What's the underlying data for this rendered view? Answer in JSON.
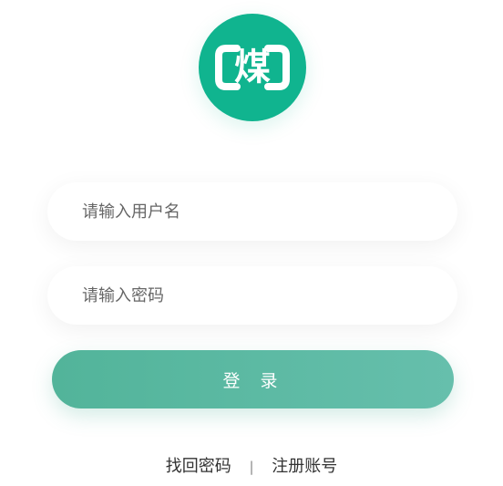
{
  "logo": {
    "icon": "coal-logo-icon",
    "char": "煤",
    "color": "#10b48f"
  },
  "form": {
    "username_placeholder": "请输入用户名",
    "password_placeholder": "请输入密码",
    "username_value": "",
    "password_value": "",
    "login_label": "登 录"
  },
  "links": {
    "forgot_password": "找回密码",
    "separator": "|",
    "register": "注册账号"
  },
  "colors": {
    "primary": "#10b48f",
    "button_start": "#52b49a",
    "button_end": "#66bfac"
  }
}
